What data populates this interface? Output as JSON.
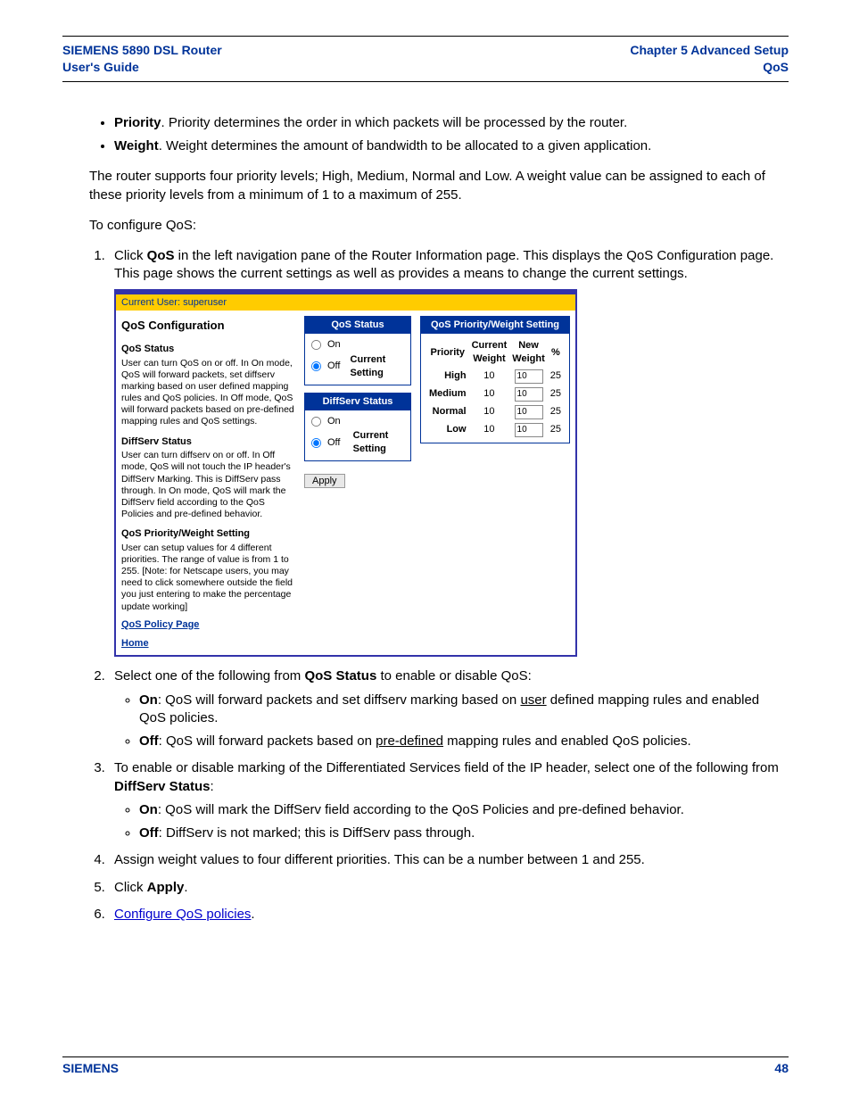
{
  "header": {
    "left1": "SIEMENS 5890 DSL Router",
    "left2": "User's Guide",
    "right1": "Chapter 5  Advanced Setup",
    "right2": "QoS"
  },
  "bullets_top": [
    {
      "bold": "Priority",
      "rest": ". Priority determines the order in which packets will be processed by the router."
    },
    {
      "bold": "Weight",
      "rest": ". Weight determines the amount of bandwidth to be allocated to a given application."
    }
  ],
  "para1": "The router supports four priority levels; High, Medium, Normal and Low. A weight value can be assigned to each of these priority levels from a minimum of 1 to a maximum of 255.",
  "para2": "To configure QoS:",
  "steps": {
    "s1a": "Click ",
    "s1b": "QoS",
    "s1c": " in the left navigation pane of the Router Information page. This displays the QoS Configuration page. This page shows the current settings as well as provides a means to change the current settings.",
    "s2a": "Select one of the following from ",
    "s2b": "QoS Status",
    "s2c": " to enable or disable QoS:",
    "s2_on_b": "On",
    "s2_on_t1": ": QoS will forward packets and set diffserv marking based on ",
    "s2_on_u": "user",
    "s2_on_t2": " defined mapping rules and enabled QoS policies.",
    "s2_off_b": "Off",
    "s2_off_t1": ": QoS will forward packets based on ",
    "s2_off_u": "pre-defined",
    "s2_off_t2": " mapping rules and enabled QoS policies.",
    "s3a": "To enable or disable marking of the Differentiated Services field of the IP header, select one of the following from ",
    "s3b": "DiffServ Status",
    "s3c": ":",
    "s3_on_b": "On",
    "s3_on_t": ": QoS will mark the DiffServ field according to the QoS Policies and pre-defined behavior.",
    "s3_off_b": "Off",
    "s3_off_t": ": DiffServ is not marked; this is DiffServ pass through.",
    "s4": "Assign weight values to four different priorities. This can be a number between 1 and 255.",
    "s5a": "Click ",
    "s5b": "Apply",
    "s5c": ".",
    "s6_link": "Configure QoS policies",
    "s6_dot": "."
  },
  "embed": {
    "topbar": "Current User: superuser",
    "title": "QoS Configuration",
    "sec1_h": "QoS Status",
    "sec1_p": "User can turn QoS on or off. In On mode, QoS will forward packets, set diffserv marking based on user defined mapping rules and QoS policies. In Off mode, QoS will forward packets based on pre-defined mapping rules and QoS settings.",
    "sec2_h": "DiffServ Status",
    "sec2_p": "User can turn diffserv on or off. In Off mode, QoS will not touch the IP header's DiffServ Marking. This is DiffServ pass through. In On mode, QoS will mark the DiffServ field according to the QoS Policies and pre-defined behavior.",
    "sec3_h": "QoS Priority/Weight Setting",
    "sec3_p": "User can setup values for 4 different priorities. The range of value is from 1 to 255. [Note: for Netscape users, you may need to click somewhere outside the field you just entering to make the percentage update working]",
    "link1": "QoS Policy Page",
    "link2": "Home",
    "panel_qos_h": "QoS Status",
    "panel_ds_h": "DiffServ Status",
    "panel_pw_h": "QoS Priority/Weight Setting",
    "on_label": "On",
    "off_label": "Off",
    "cur_setting": "Current Setting",
    "apply": "Apply",
    "th_priority": "Priority",
    "th_cur": "Current Weight",
    "th_new": "New Weight",
    "th_pct": "%",
    "rows": [
      {
        "p": "High",
        "cur": "10",
        "new": "10",
        "pct": "25"
      },
      {
        "p": "Medium",
        "cur": "10",
        "new": "10",
        "pct": "25"
      },
      {
        "p": "Normal",
        "cur": "10",
        "new": "10",
        "pct": "25"
      },
      {
        "p": "Low",
        "cur": "10",
        "new": "10",
        "pct": "25"
      }
    ]
  },
  "footer": {
    "left": "SIEMENS",
    "right": "48"
  }
}
